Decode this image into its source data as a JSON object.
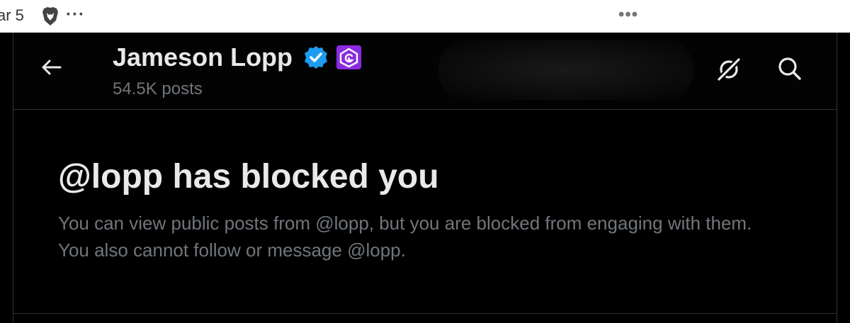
{
  "browser": {
    "date_fragment": "ar 5",
    "menu_dots_left": "···",
    "menu_dots_right": "•••"
  },
  "header": {
    "name": "Jameson Lopp",
    "post_count": "54.5K posts",
    "icons": {
      "back": "arrow-left-icon",
      "verified": "verified-badge-icon",
      "affiliate": "affiliate-badge-icon",
      "grok": "grok-icon",
      "search": "search-icon"
    }
  },
  "blocked": {
    "title": "@lopp has blocked you",
    "description": "You can view public posts from @lopp, but you are blocked from engaging with them. You also cannot follow or message @lopp."
  },
  "colors": {
    "background": "#000000",
    "primary_text": "#e7e9ea",
    "secondary_text": "#71767b",
    "border": "#2f3336",
    "verified_blue": "#1d9bf0",
    "affiliate_purple": "#8b2be2"
  }
}
